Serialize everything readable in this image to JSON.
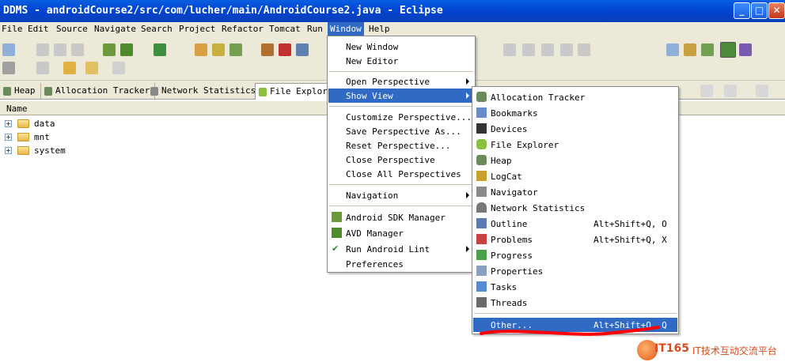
{
  "window": {
    "title": "DDMS - androidCourse2/src/com/lucher/main/AndroidCourse2.java - Eclipse",
    "minimize": "_",
    "maximize": "□",
    "close": "✕"
  },
  "menubar": {
    "items": [
      "File",
      "Edit",
      "Source",
      "Navigate",
      "Search",
      "Project",
      "Refactor",
      "Tomcat",
      "Run",
      "Window",
      "Help"
    ],
    "active": "Window"
  },
  "tabs": [
    {
      "label": "Heap",
      "icon": "heap-icon"
    },
    {
      "label": "Allocation Tracker",
      "icon": "allocation-tracker-icon"
    },
    {
      "label": "Network Statistics",
      "icon": "network-icon"
    },
    {
      "label": "File Explorer",
      "icon": "android-icon"
    }
  ],
  "file_tree": {
    "column_header": "Name",
    "rows": [
      {
        "label": "data",
        "expander": "+"
      },
      {
        "label": "mnt",
        "expander": "+"
      },
      {
        "label": "system",
        "expander": "+"
      }
    ]
  },
  "window_menu": {
    "items": [
      {
        "label": "New Window"
      },
      {
        "label": "New Editor"
      },
      {
        "label": "Open Perspective",
        "submenu": true
      },
      {
        "label": "Show View",
        "submenu": true,
        "highlighted": true
      },
      {
        "label": "Customize Perspective..."
      },
      {
        "label": "Save Perspective As..."
      },
      {
        "label": "Reset Perspective..."
      },
      {
        "label": "Close Perspective"
      },
      {
        "label": "Close All Perspectives"
      },
      {
        "label": "Navigation",
        "submenu": true
      },
      {
        "label": "Android SDK Manager",
        "icon": "android-sdk-icon"
      },
      {
        "label": "AVD Manager",
        "icon": "avd-icon"
      },
      {
        "label": "Run Android Lint",
        "icon": "checkmark-icon",
        "submenu": true
      },
      {
        "label": "Preferences"
      }
    ]
  },
  "show_view_menu": {
    "items": [
      {
        "label": "Allocation Tracker",
        "icon": "allocation-tracker-icon"
      },
      {
        "label": "Bookmarks",
        "icon": "bookmark-icon"
      },
      {
        "label": "Devices",
        "icon": "device-icon"
      },
      {
        "label": "File Explorer",
        "icon": "android-icon"
      },
      {
        "label": "Heap",
        "icon": "heap-icon"
      },
      {
        "label": "LogCat",
        "icon": "logcat-icon"
      },
      {
        "label": "Navigator",
        "icon": "navigator-icon"
      },
      {
        "label": "Network Statistics",
        "icon": "network-icon"
      },
      {
        "label": "Outline",
        "icon": "outline-icon",
        "accelerator": "Alt+Shift+Q, O"
      },
      {
        "label": "Problems",
        "icon": "problems-icon",
        "accelerator": "Alt+Shift+Q, X"
      },
      {
        "label": "Progress",
        "icon": "progress-icon"
      },
      {
        "label": "Properties",
        "icon": "properties-icon"
      },
      {
        "label": "Tasks",
        "icon": "tasks-icon"
      },
      {
        "label": "Threads",
        "icon": "threads-icon"
      },
      {
        "label": "Other...",
        "accelerator": "Alt+Shift+Q, Q",
        "highlighted": true
      }
    ]
  },
  "watermark": {
    "brand": "IT165",
    "tagline": "IT技术互动交流平台"
  },
  "colors": {
    "highlight": "#316ac5",
    "title_bar": "#0046d5",
    "chrome": "#ece9d8",
    "annotation_red": "#ff0000"
  }
}
